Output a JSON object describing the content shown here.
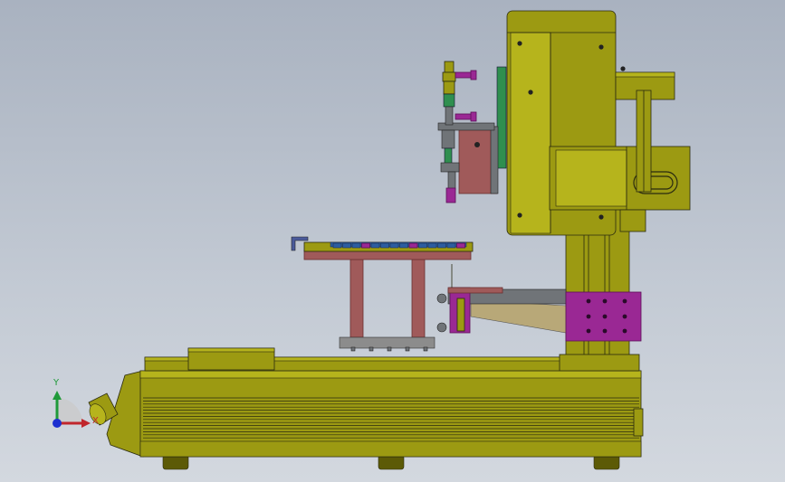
{
  "scene": {
    "description_visible": false
  },
  "triad": {
    "y_label": "Y",
    "x_label": "X",
    "y_color": "#1f9a3a",
    "x_color": "#c0262c",
    "origin_color": "#1c2fd0"
  },
  "colors": {
    "frame": "#9c9a12",
    "frame_light": "#b6b41c",
    "frame_dark": "#5c5a06",
    "edge": "#2a2a10",
    "column_purple": "#9a2894",
    "purple_dark": "#5c1058",
    "copper": "#a05a5a",
    "copper_dark": "#6a3030",
    "gray_plate": "#8c8c8c",
    "steel": "#707478",
    "table_blue": "#2c5da0",
    "bracket_tan": "#b8a878",
    "green_part": "#2f8f4f"
  }
}
